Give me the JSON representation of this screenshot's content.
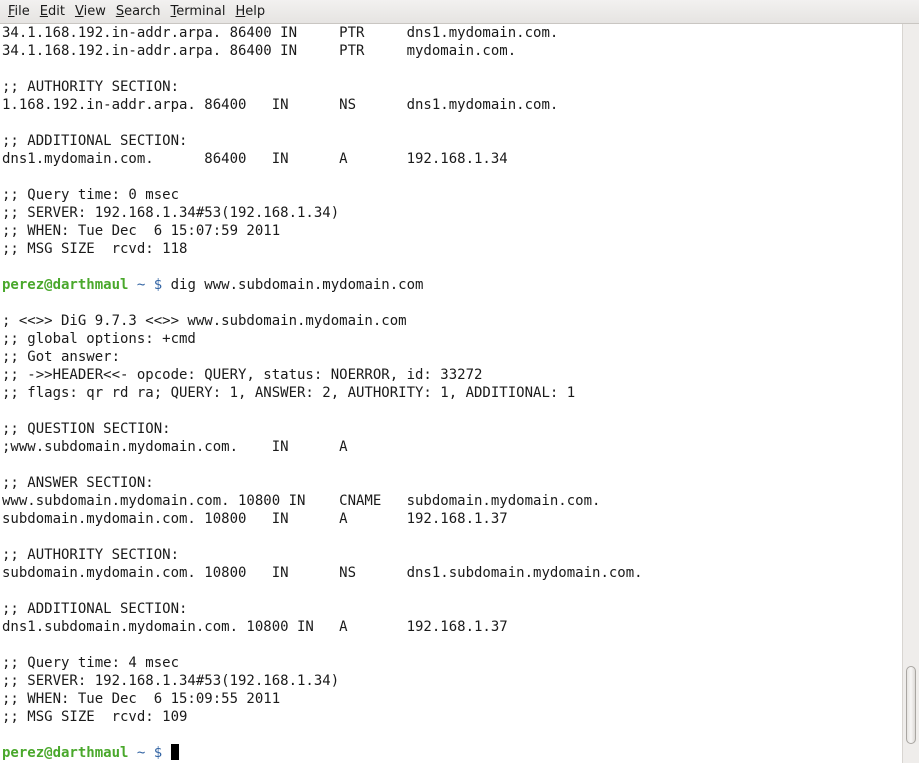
{
  "menu": {
    "items": [
      {
        "label": "File",
        "key": "F",
        "rest": "ile"
      },
      {
        "label": "Edit",
        "key": "E",
        "rest": "dit"
      },
      {
        "label": "View",
        "key": "V",
        "rest": "iew"
      },
      {
        "label": "Search",
        "key": "S",
        "rest": "earch"
      },
      {
        "label": "Terminal",
        "key": "T",
        "rest": "erminal"
      },
      {
        "label": "Help",
        "key": "H",
        "rest": "elp"
      }
    ]
  },
  "terminal": {
    "lines": [
      "34.1.168.192.in-addr.arpa. 86400 IN     PTR     dns1.mydomain.com.",
      "34.1.168.192.in-addr.arpa. 86400 IN     PTR     mydomain.com.",
      "",
      ";; AUTHORITY SECTION:",
      "1.168.192.in-addr.arpa. 86400   IN      NS      dns1.mydomain.com.",
      "",
      ";; ADDITIONAL SECTION:",
      "dns1.mydomain.com.      86400   IN      A       192.168.1.34",
      "",
      ";; Query time: 0 msec",
      ";; SERVER: 192.168.1.34#53(192.168.1.34)",
      ";; WHEN: Tue Dec  6 15:07:59 2011",
      ";; MSG SIZE  rcvd: 118",
      "",
      {
        "prompt": {
          "user": "perez@darthmaul",
          "path": " ~ $ ",
          "command": "dig www.subdomain.mydomain.com"
        }
      },
      "",
      "; <<>> DiG 9.7.3 <<>> www.subdomain.mydomain.com",
      ";; global options: +cmd",
      ";; Got answer:",
      ";; ->>HEADER<<- opcode: QUERY, status: NOERROR, id: 33272",
      ";; flags: qr rd ra; QUERY: 1, ANSWER: 2, AUTHORITY: 1, ADDITIONAL: 1",
      "",
      ";; QUESTION SECTION:",
      ";www.subdomain.mydomain.com.    IN      A",
      "",
      ";; ANSWER SECTION:",
      "www.subdomain.mydomain.com. 10800 IN    CNAME   subdomain.mydomain.com.",
      "subdomain.mydomain.com. 10800   IN      A       192.168.1.37",
      "",
      ";; AUTHORITY SECTION:",
      "subdomain.mydomain.com. 10800   IN      NS      dns1.subdomain.mydomain.com.",
      "",
      ";; ADDITIONAL SECTION:",
      "dns1.subdomain.mydomain.com. 10800 IN   A       192.168.1.37",
      "",
      ";; Query time: 4 msec",
      ";; SERVER: 192.168.1.34#53(192.168.1.34)",
      ";; WHEN: Tue Dec  6 15:09:55 2011",
      ";; MSG SIZE  rcvd: 109",
      "",
      {
        "prompt": {
          "user": "perez@darthmaul",
          "path": " ~ $ ",
          "command": ""
        },
        "cursor": true
      }
    ]
  },
  "colors": {
    "prompt_user": "#4aa82c",
    "prompt_path": "#3465a4",
    "text": "#1a1a1a",
    "background": "#ffffff"
  }
}
